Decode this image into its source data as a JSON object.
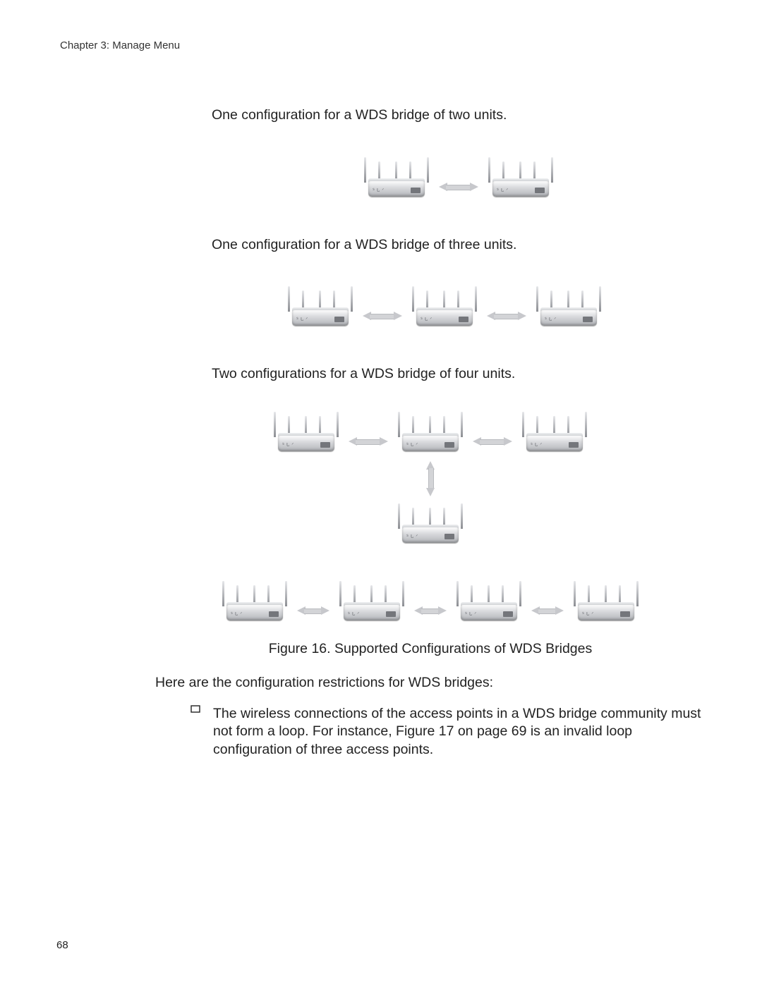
{
  "chapter_header": "Chapter 3: Manage Menu",
  "sections": {
    "two_units": "One configuration for a WDS bridge of two units.",
    "three_units": "One configuration for a WDS bridge of three units.",
    "four_units": "Two configurations for a WDS bridge of four units."
  },
  "figure_caption": "Figure 16. Supported Configurations of WDS Bridges",
  "restrictions_intro": "Here are the configuration restrictions for WDS bridges:",
  "restrictions": [
    "The wireless connections of the access points in a WDS bridge community must not form a loop. For instance, Figure 17 on page 69 is an invalid loop configuration of three access points."
  ],
  "device_label": "ᔆ ᒐ ᐟ",
  "page_number": "68"
}
